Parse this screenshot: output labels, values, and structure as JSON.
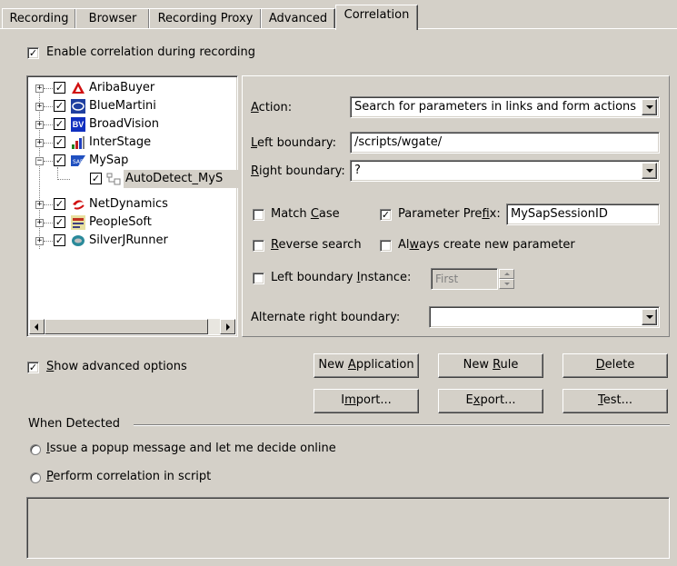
{
  "tabs": [
    {
      "label": "Recording",
      "active": false
    },
    {
      "label": "Browser",
      "active": false
    },
    {
      "label": "Recording Proxy",
      "active": false
    },
    {
      "label": "Advanced",
      "active": false
    },
    {
      "label": "Correlation",
      "active": true
    }
  ],
  "enable_correlation": {
    "label": "Enable correlation during recording",
    "checked": true
  },
  "tree": {
    "items": [
      {
        "label": "AribaBuyer",
        "checked": true,
        "icon": "ariba-icon"
      },
      {
        "label": "BlueMartini",
        "checked": true,
        "icon": "bluemartini-icon"
      },
      {
        "label": "BroadVision",
        "checked": true,
        "icon": "broadvision-icon",
        "icon_text": "BV"
      },
      {
        "label": "InterStage",
        "checked": true,
        "icon": "interstage-icon"
      },
      {
        "label": "MySap",
        "checked": true,
        "icon": "sap-icon",
        "expanded": true
      },
      {
        "label": "AutoDetect_MyS",
        "checked": true,
        "icon": "rule-icon",
        "child": true,
        "selected": true
      },
      {
        "label": "NetDynamics",
        "checked": true,
        "icon": "netdynamics-icon"
      },
      {
        "label": "PeopleSoft",
        "checked": true,
        "icon": "peoplesoft-icon"
      },
      {
        "label": "SilverJRunner",
        "checked": true,
        "icon": "silverjrunner-icon"
      }
    ]
  },
  "rule": {
    "action_label": "Action:",
    "action_value": "Search for parameters in links and form actions",
    "left_boundary_label": "Left boundary:",
    "left_boundary_value": "/scripts/wgate/",
    "right_boundary_label": "Right boundary:",
    "right_boundary_value": "?",
    "match_case_label": "Match Case",
    "match_case_checked": false,
    "param_prefix_label": "Parameter Prefix:",
    "param_prefix_checked": true,
    "param_prefix_value": "MySapSessionID",
    "reverse_search_label": "Reverse search",
    "reverse_search_checked": false,
    "always_create_label": "Always create new parameter",
    "always_create_checked": false,
    "left_instance_label": "Left boundary Instance:",
    "left_instance_checked": false,
    "left_instance_value": "First",
    "alt_right_label": "Alternate right boundary:",
    "alt_right_value": ""
  },
  "show_advanced": {
    "label": "Show advanced options",
    "checked": true
  },
  "buttons": {
    "new_application": "New Application",
    "new_rule": "New Rule",
    "delete": "Delete",
    "import": "Import...",
    "export": "Export...",
    "test": "Test..."
  },
  "when_detected": {
    "title": "When Detected",
    "option1": "Issue a popup message and let me decide online",
    "option2": "Perform correlation in script"
  }
}
